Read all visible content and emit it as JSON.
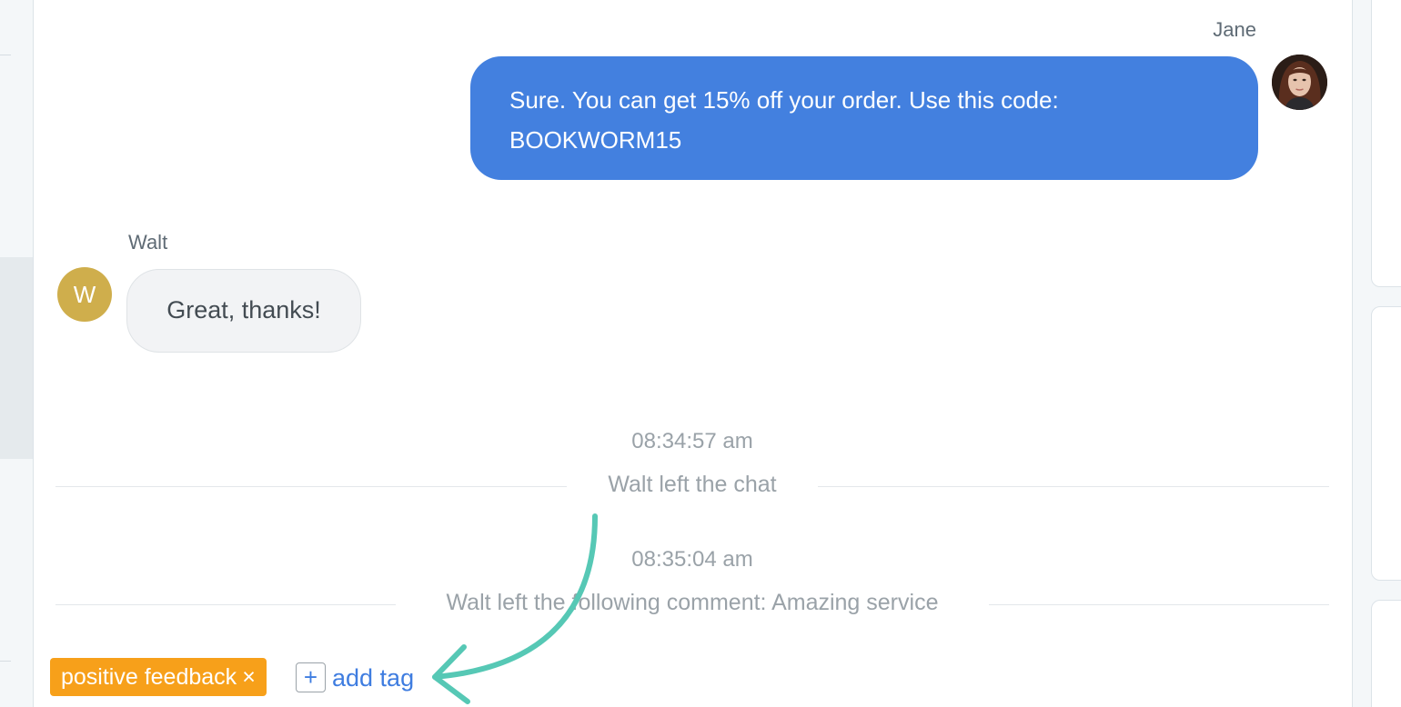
{
  "agent_message": {
    "sender": "Jane",
    "text_line1": "Sure. You can get 15% off your order. Use this code:",
    "text_line2": "BOOKWORM15"
  },
  "visitor_message": {
    "sender": "Walt",
    "avatar_letter": "W",
    "text": "Great, thanks!"
  },
  "events": [
    {
      "time": "08:34:57 am",
      "text": "Walt left the chat"
    },
    {
      "time": "08:35:04 am",
      "text": "Walt left the following comment: Amazing service"
    }
  ],
  "tags": {
    "items": [
      {
        "label": "positive feedback",
        "remove_glyph": "×"
      }
    ],
    "add_glyph": "+",
    "add_label": "add tag"
  },
  "colors": {
    "agent_bubble": "#4380df",
    "visitor_avatar": "#cfae4c",
    "tag_chip": "#f7a01a",
    "link": "#3f7de0",
    "annotation_arrow": "#56c8b5"
  },
  "icons": {
    "agent_avatar": "agent-photo-avatar",
    "annotation": "curved-arrow-icon"
  }
}
